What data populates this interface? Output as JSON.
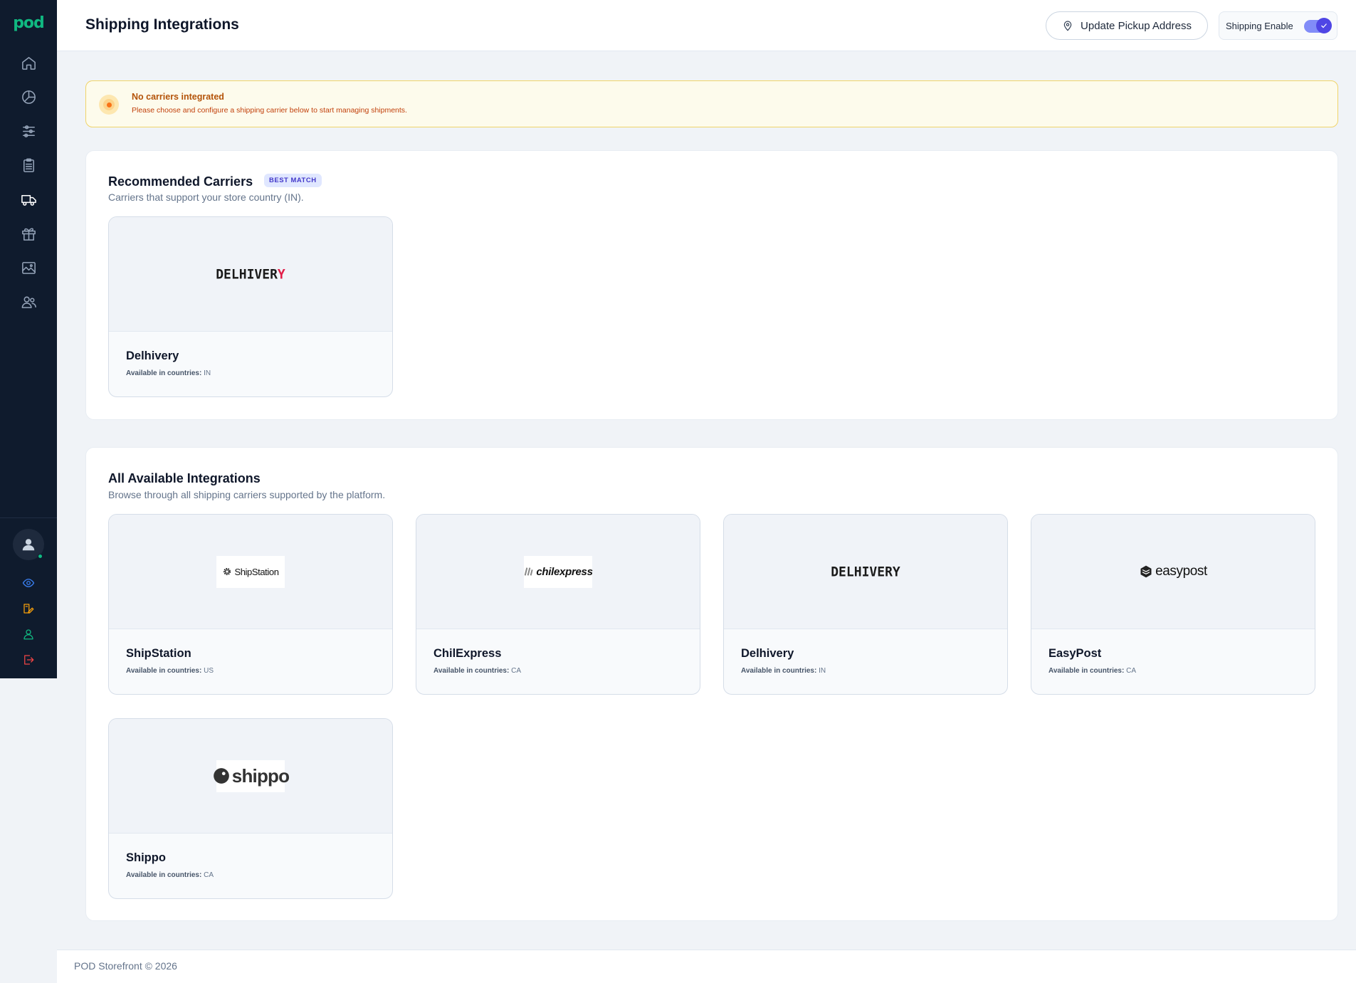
{
  "app": {
    "logo_text": "pod",
    "page_title": "Shipping Integrations"
  },
  "header": {
    "update_pickup_label": "Update Pickup Address",
    "shipping_enable_label": "Shipping Enable",
    "shipping_enabled": true
  },
  "sidebar": {
    "items": [
      {
        "name": "home-icon",
        "active": false
      },
      {
        "name": "analytics-icon",
        "active": false
      },
      {
        "name": "settings-sliders-icon",
        "active": false
      },
      {
        "name": "orders-clipboard-icon",
        "active": false
      },
      {
        "name": "shipping-truck-icon",
        "active": true
      },
      {
        "name": "gift-icon",
        "active": false
      },
      {
        "name": "gallery-image-icon",
        "active": false
      },
      {
        "name": "users-icon",
        "active": false
      }
    ],
    "bottom": [
      {
        "name": "eye-icon",
        "color": "#3b82f6"
      },
      {
        "name": "edit-store-icon",
        "color": "#f59e0b"
      },
      {
        "name": "profile-icon",
        "color": "#10b981"
      },
      {
        "name": "logout-icon",
        "color": "#ef4444"
      }
    ]
  },
  "alert": {
    "title": "No carriers integrated",
    "text": "Please choose and configure a shipping carrier below to start managing shipments."
  },
  "recommended": {
    "title": "Recommended Carriers",
    "badge": "BEST MATCH",
    "subtitle": "Carriers that support your store country (IN).",
    "cards": [
      {
        "name": "Delhivery",
        "avail_label": "Available in countries:",
        "countries": "IN",
        "logo_text": "DELHIVERY"
      }
    ]
  },
  "all": {
    "title": "All Available Integrations",
    "subtitle": "Browse through all shipping carriers supported by the platform.",
    "cards": [
      {
        "name": "ShipStation",
        "avail_label": "Available in countries:",
        "countries": "US",
        "logo_text": "ShipStation"
      },
      {
        "name": "ChilExpress",
        "avail_label": "Available in countries:",
        "countries": "CA",
        "logo_text": "chilexpress"
      },
      {
        "name": "Delhivery",
        "avail_label": "Available in countries:",
        "countries": "IN",
        "logo_text": "DELHIVERY"
      },
      {
        "name": "EasyPost",
        "avail_label": "Available in countries:",
        "countries": "CA",
        "logo_text": "easypost"
      },
      {
        "name": "Shippo",
        "avail_label": "Available in countries:",
        "countries": "CA",
        "logo_text": "shippo"
      }
    ]
  },
  "footer": {
    "text": "POD Storefront © 2026"
  },
  "colors": {
    "accent": "#4f46e5",
    "sidebar_bg": "#0f1b2d",
    "brand_green": "#10b981",
    "alert_border": "#f0d46a"
  }
}
